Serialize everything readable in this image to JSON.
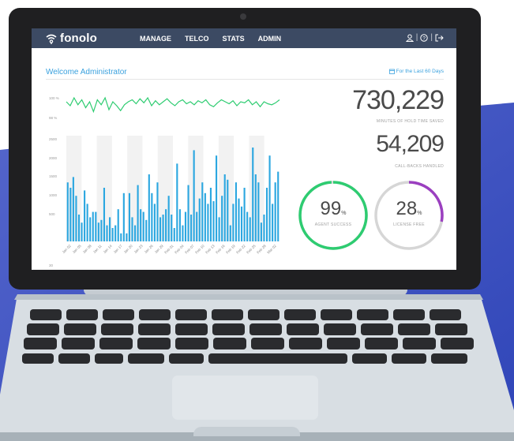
{
  "app": {
    "logo": "fonolo"
  },
  "nav": {
    "items": [
      "MANAGE",
      "TELCO",
      "STATS",
      "ADMIN"
    ]
  },
  "header": {
    "welcome": "Welcome Administrator",
    "range": "For the Last 60 Days"
  },
  "stats": {
    "minutes_value": "730,229",
    "minutes_label": "MINUTES OF HOLD TIME SAVED",
    "callbacks_value": "54,209",
    "callbacks_label": "CALL-BACKS HANDLED"
  },
  "gauges": [
    {
      "value": "99",
      "unit": "%",
      "label": "AGENT SUCCESS",
      "fraction": 0.99,
      "color": "#2ecc71"
    },
    {
      "value": "28",
      "unit": "%",
      "label": "LICENSE FREE",
      "fraction": 0.28,
      "color": "#9b3fc0"
    }
  ],
  "colors": {
    "topbar": "#3c4a63",
    "accent": "#3aa1de",
    "bar": "#2ca7e0"
  },
  "chart_data": {
    "type": "bar",
    "line_series": {
      "ylim": [
        98,
        100
      ],
      "yticks": [
        "100 %",
        "98 %"
      ],
      "values": [
        99.6,
        99.2,
        100,
        99.3,
        99.8,
        99.0,
        99.6,
        98.6,
        99.8,
        99.3,
        100,
        98.8,
        99.6,
        99.2,
        98.7,
        99.3,
        99.6,
        99.8,
        99.4,
        99.9,
        99.5,
        100,
        99.2,
        99.7,
        99.3,
        99.6,
        99.9,
        99.5,
        99.2,
        99.6,
        99.8,
        99.4,
        99.6,
        99.3,
        99.7,
        99.5,
        99.8,
        99.3,
        99.1,
        99.5,
        99.8,
        99.6,
        99.4,
        99.7,
        99.2,
        99.6,
        99.5,
        99.8,
        99.3,
        99.6,
        99.1,
        99.6,
        99.4,
        99.3,
        99.5,
        99.8
      ]
    },
    "ylim": [
      0,
      2500
    ],
    "yticks": [
      "2500",
      "2000",
      "1500",
      "1000",
      "500",
      "30"
    ],
    "categories": [
      "Jan 02",
      "Jan 05",
      "Jan 08",
      "Jan 11",
      "Jan 14",
      "Jan 17",
      "Jan 20",
      "Jan 23",
      "Jan 26",
      "Jan 29",
      "Feb 01",
      "Feb 04",
      "Feb 07",
      "Feb 10",
      "Feb 13",
      "Feb 16",
      "Feb 19",
      "Feb 22",
      "Feb 25",
      "Feb 28",
      "Mar 02"
    ],
    "values": [
      1100,
      1000,
      1200,
      850,
      500,
      350,
      950,
      700,
      450,
      550,
      550,
      350,
      400,
      1000,
      300,
      450,
      250,
      300,
      600,
      150,
      900,
      150,
      900,
      450,
      300,
      1050,
      600,
      550,
      400,
      1250,
      900,
      700,
      1100,
      450,
      500,
      600,
      850,
      500,
      250,
      1450,
      600,
      300,
      550,
      1050,
      500,
      1700,
      550,
      800,
      1100,
      900,
      700,
      1000,
      750,
      1600,
      450,
      850,
      1250,
      1150,
      300,
      700,
      1100,
      800,
      650,
      1000,
      550,
      450,
      1750,
      1250,
      1100,
      350,
      500,
      1000,
      1600,
      700,
      1100,
      1300
    ]
  }
}
